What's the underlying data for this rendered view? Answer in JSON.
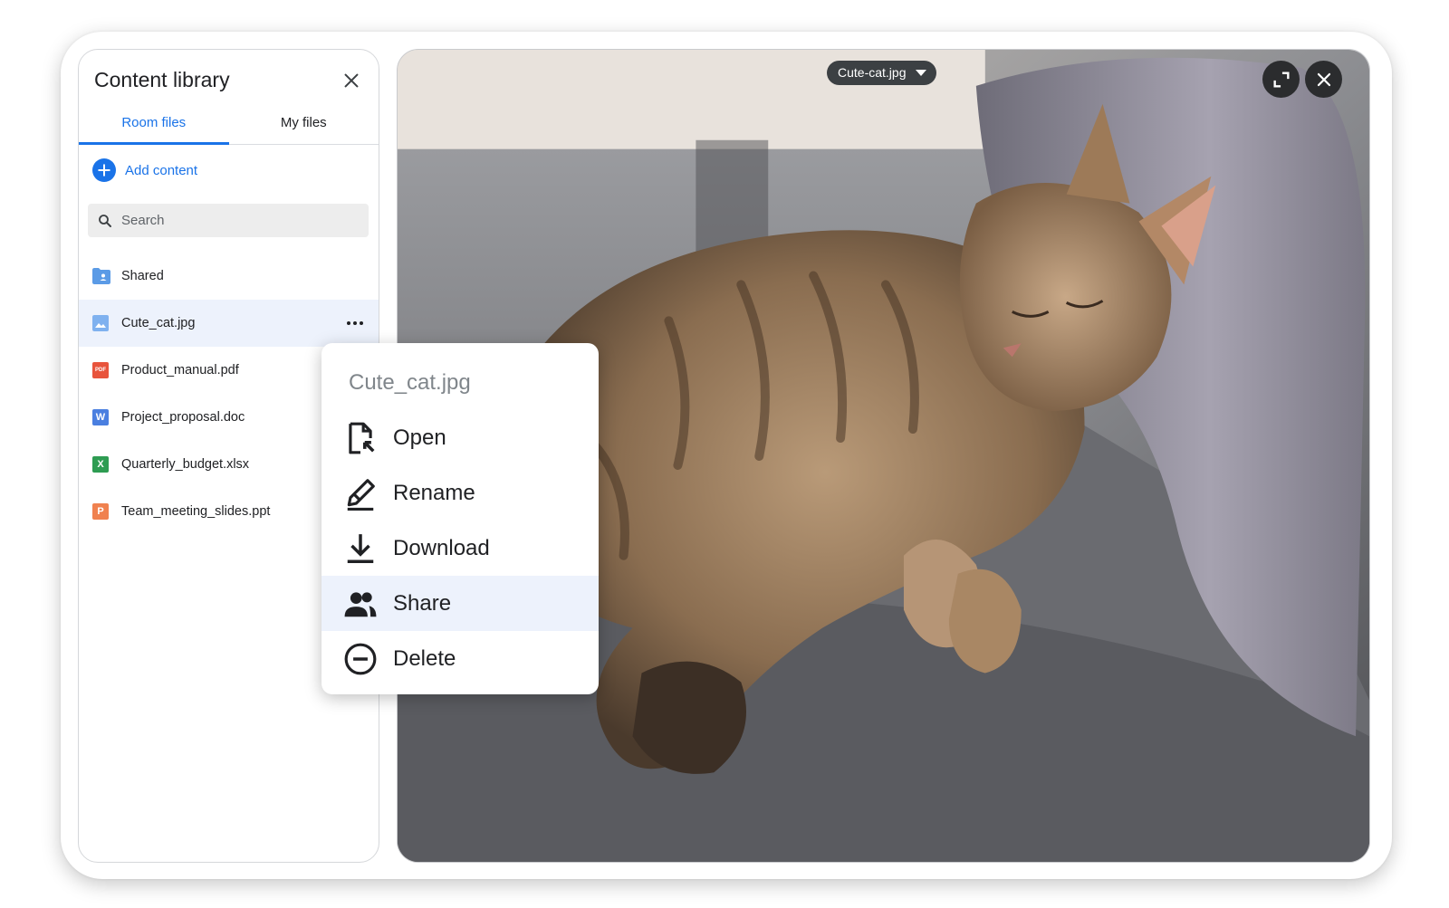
{
  "panel": {
    "title": "Content library",
    "close_icon": "close-icon",
    "tabs": [
      {
        "label": "Room files",
        "active": true
      },
      {
        "label": "My files",
        "active": false
      }
    ],
    "add_content_label": "Add content",
    "search_placeholder": "Search",
    "files": [
      {
        "name": "Shared",
        "icon": "shared-folder-icon",
        "color": "#5b9be6"
      },
      {
        "name": "Cute_cat.jpg",
        "icon": "image-file-icon",
        "color": "#7fb1ef",
        "selected": true
      },
      {
        "name": "Product_manual.pdf",
        "icon": "pdf-file-icon",
        "color": "#e8543c",
        "glyph": "PDF"
      },
      {
        "name": "Project_proposal.doc",
        "icon": "word-file-icon",
        "color": "#4a7fe0",
        "glyph": "W"
      },
      {
        "name": "Quarterly_budget.xlsx",
        "icon": "excel-file-icon",
        "color": "#2e9c52",
        "glyph": "X"
      },
      {
        "name": "Team_meeting_slides.ppt",
        "icon": "powerpoint-file-icon",
        "color": "#f0814f",
        "glyph": "P"
      }
    ]
  },
  "viewer": {
    "file_chip_label": "Cute-cat.jpg",
    "expand_icon": "expand-icon",
    "close_icon": "close-icon"
  },
  "context_menu": {
    "title": "Cute_cat.jpg",
    "items": [
      {
        "label": "Open",
        "icon": "open-file-icon"
      },
      {
        "label": "Rename",
        "icon": "rename-pen-icon"
      },
      {
        "label": "Download",
        "icon": "download-icon"
      },
      {
        "label": "Share",
        "icon": "share-people-icon",
        "highlighted": true
      },
      {
        "label": "Delete",
        "icon": "delete-circle-icon"
      }
    ]
  },
  "colors": {
    "accent": "#1a73e8",
    "selected_row": "#edf2fc",
    "chip_background": "#3c4043"
  }
}
